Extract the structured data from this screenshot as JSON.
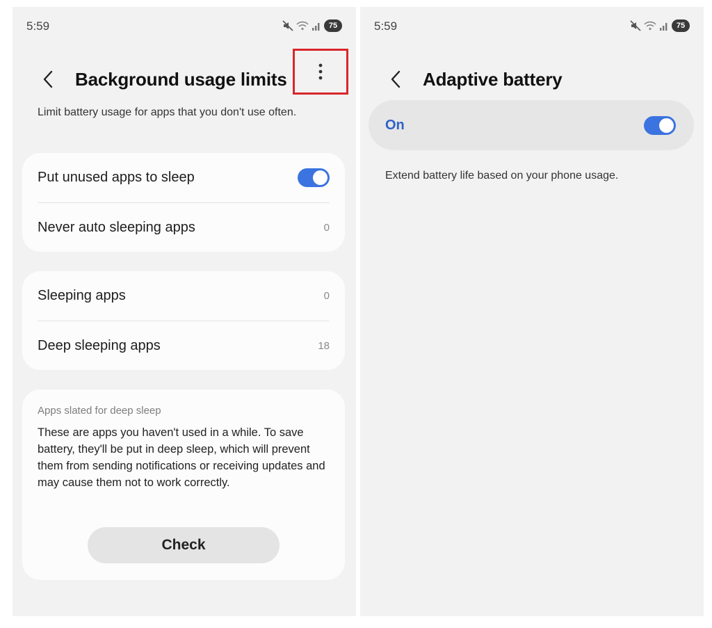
{
  "left": {
    "status": {
      "time": "5:59",
      "battery": "75"
    },
    "header": {
      "title": "Background usage limits"
    },
    "description": "Limit battery usage for apps that you don't use often.",
    "group1": {
      "put_unused_label": "Put unused apps to sleep",
      "put_unused_on": true,
      "never_auto_label": "Never auto sleeping apps",
      "never_auto_count": "0"
    },
    "group2": {
      "sleeping_label": "Sleeping apps",
      "sleeping_count": "0",
      "deep_sleeping_label": "Deep sleeping apps",
      "deep_sleeping_count": "18"
    },
    "info": {
      "heading": "Apps slated for deep sleep",
      "body": "These are apps you haven't used in a while. To save battery, they'll be put in deep sleep, which will prevent them from sending notifications or receiving updates and may cause them not to work correctly.",
      "button": "Check"
    }
  },
  "right": {
    "status": {
      "time": "5:59",
      "battery": "75"
    },
    "header": {
      "title": "Adaptive battery"
    },
    "switch": {
      "label": "On",
      "on": true
    },
    "description": "Extend battery life based on your phone usage."
  },
  "colors": {
    "accent": "#3b73e0",
    "highlight": "#d9262b",
    "on_label": "#2f62c9"
  }
}
